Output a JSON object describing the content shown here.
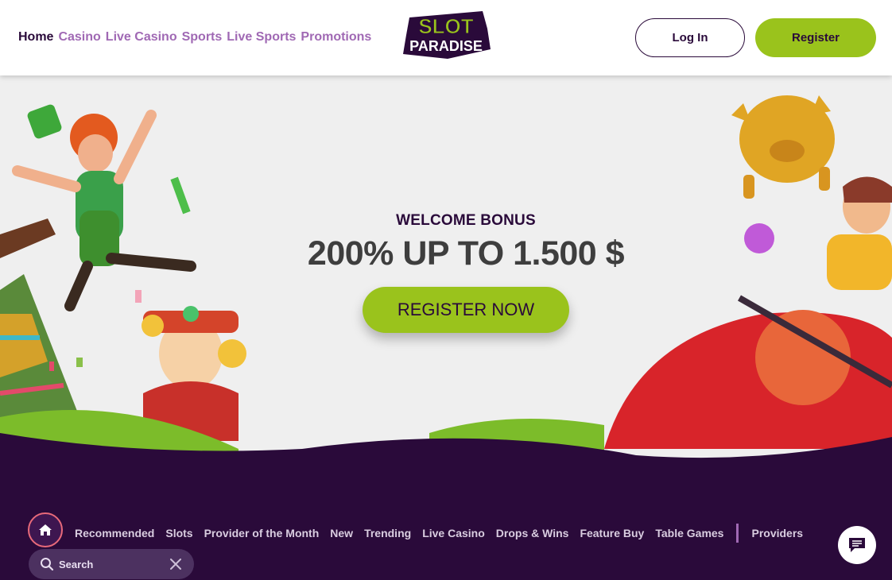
{
  "header": {
    "nav": [
      "Home",
      "Casino",
      "Live Casino",
      "Sports",
      "Live Sports",
      "Promotions"
    ],
    "logo_top": "SLOT",
    "logo_bottom": "PARADISE",
    "login_label": "Log In",
    "register_label": "Register"
  },
  "hero": {
    "title": "WELCOME BONUS",
    "amount": "200% UP TO 1.500 $",
    "cta": "REGISTER NOW"
  },
  "categories": {
    "items": [
      "Recommended",
      "Slots",
      "Provider of the Month",
      "New",
      "Trending",
      "Live Casino",
      "Drops & Wins",
      "Feature Buy",
      "Table Games"
    ],
    "providers": "Providers"
  },
  "search": {
    "placeholder": "Search"
  },
  "icons": [
    "home-icon",
    "search-icon",
    "close-icon",
    "chat-icon"
  ],
  "colors": {
    "accent": "#9ac31c",
    "dark": "#2a0a3a",
    "purple": "#a069b4",
    "hero_bg": "#efefef"
  }
}
